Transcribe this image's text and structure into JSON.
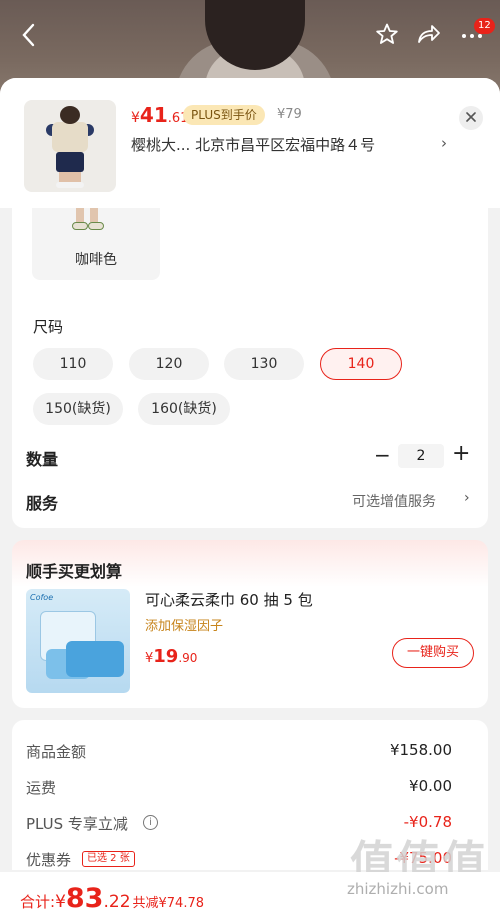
{
  "header": {
    "back_icon": "chevron-left-icon",
    "badge_count": "12"
  },
  "product": {
    "price_currency": "¥",
    "price_int": "41",
    "price_dec": ".61",
    "plus_tag": "PLUS到手价",
    "original_price": "¥79",
    "address": "樱桃大...  北京市昌平区宏福中路４号",
    "address_chevron": "›"
  },
  "options": {
    "color_label": "咖啡色",
    "size_title": "尺码",
    "sizes": [
      "110",
      "120",
      "130",
      "140",
      "150(缺货)",
      "160(缺货)"
    ],
    "selected_size": "140"
  },
  "quantity": {
    "label": "数量",
    "minus": "−",
    "value": "2",
    "plus": "+"
  },
  "service": {
    "label": "服务",
    "value": "可选增值服务",
    "chevron": "›"
  },
  "recommend": {
    "title": "顺手买更划算",
    "image_brand": "Cofoe",
    "name": "可心柔云柔巾 60 抽 5 包",
    "subtitle": "添加保湿因子",
    "price_currency": "¥",
    "price_int": "19",
    "price_dec": ".90",
    "buy_label": "一键购买"
  },
  "totals": {
    "goods_label": "商品金额",
    "goods_value": "¥158.00",
    "shipping_label": "运费",
    "shipping_value": "¥0.00",
    "plus_label": "PLUS 专享立减",
    "plus_value": "-¥0.78",
    "coupon_label": "优惠券",
    "coupon_tag": "已选 2 张",
    "coupon_value": "-¥75.00"
  },
  "bottom": {
    "total_label": "合计:",
    "total_currency": "¥",
    "total_int": "83",
    "total_dec": ".22",
    "savings": "共减¥74.78"
  },
  "watermark": {
    "big": "值值值",
    "small": "zhizhizhi.com"
  },
  "colors": {
    "accent_red": "#e8231a",
    "plus_gold_bg": "#fbe7b5",
    "subtitle_gold": "#c7851d"
  }
}
